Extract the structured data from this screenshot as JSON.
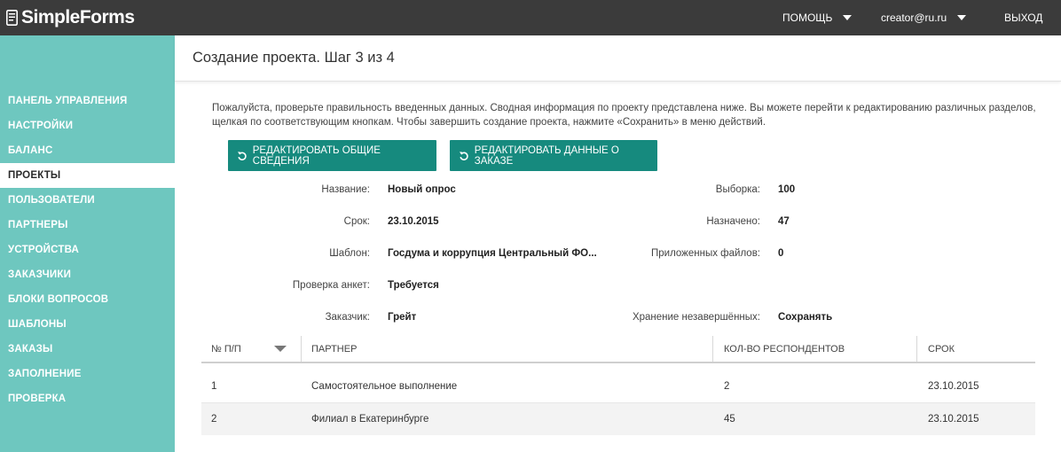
{
  "topbar": {
    "logo": "SimpleForms",
    "help": "ПОМОЩЬ",
    "user": "creator@ru.ru",
    "logout": "ВЫХОД"
  },
  "sidebar": {
    "items": [
      {
        "label": "ПАНЕЛЬ УПРАВЛЕНИЯ",
        "active": false
      },
      {
        "label": "НАСТРОЙКИ",
        "active": false
      },
      {
        "label": "БАЛАНС",
        "active": false
      },
      {
        "label": "ПРОЕКТЫ",
        "active": true
      },
      {
        "label": "ПОЛЬЗОВАТЕЛИ",
        "active": false
      },
      {
        "label": "ПАРТНЕРЫ",
        "active": false
      },
      {
        "label": "УСТРОЙСТВА",
        "active": false
      },
      {
        "label": "ЗАКАЗЧИКИ",
        "active": false
      },
      {
        "label": "БЛОКИ ВОПРОСОВ",
        "active": false
      },
      {
        "label": "ШАБЛОНЫ",
        "active": false
      },
      {
        "label": "ЗАКАЗЫ",
        "active": false
      },
      {
        "label": "ЗАПОЛНЕНИЕ",
        "active": false
      },
      {
        "label": "ПРОВЕРКА",
        "active": false
      }
    ]
  },
  "page": {
    "title": "Создание проекта. Шаг 3 из 4",
    "info": "Пожалуйста, проверьте правильность введенных данных. Сводная информация по проекту представлена ниже. Вы можете перейти к редактированию различных разделов, щелкая по соответствующим кнопкам. Чтобы завершить создание проекта, нажмите «Сохранить» в меню действий."
  },
  "actions": {
    "edit_general": "РЕДАКТИРОВАТЬ ОБЩИЕ СВЕДЕНИЯ",
    "edit_order": "РЕДАКТИРОВАТЬ ДАННЫЕ О ЗАКАЗЕ"
  },
  "summary": {
    "left": [
      {
        "label": "Название:",
        "value": "Новый опрос"
      },
      {
        "label": "Срок:",
        "value": "23.10.2015"
      },
      {
        "label": "Шаблон:",
        "value": "Госдума и коррупция Центральный ФО..."
      },
      {
        "label": "Проверка анкет:",
        "value": "Требуется"
      },
      {
        "label": "Заказчик:",
        "value": "Грейт"
      }
    ],
    "right": [
      {
        "label": "Выборка:",
        "value": "100"
      },
      {
        "label": "Назначено:",
        "value": "47"
      },
      {
        "label": "Приложенных файлов:",
        "value": "0"
      },
      {
        "label": "Хранение незавершённых:",
        "value": "Сохранять"
      }
    ]
  },
  "table": {
    "headers": {
      "num": "№ П/П",
      "partner": "ПАРТНЕР",
      "respondents": "КОЛ-ВО РЕСПОНДЕНТОВ",
      "deadline": "СРОК"
    },
    "rows": [
      {
        "num": "1",
        "partner": "Самостоятельное выполнение",
        "respondents": "2",
        "deadline": "23.10.2015"
      },
      {
        "num": "2",
        "partner": "Филиал в Екатеринбурге",
        "respondents": "45",
        "deadline": "23.10.2015"
      }
    ]
  },
  "colors": {
    "topbar": "#3b3b3b",
    "sidebar": "#6ec7bf",
    "button": "#168a7e"
  }
}
